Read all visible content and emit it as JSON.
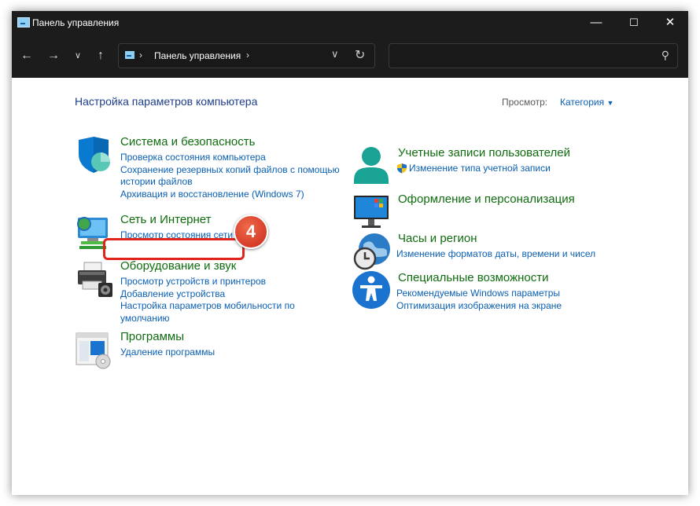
{
  "window": {
    "title": "Панель управления"
  },
  "address": {
    "crumb": "Панель управления"
  },
  "search": {
    "placeholder": ""
  },
  "heading": "Настройка параметров компьютера",
  "view": {
    "label": "Просмотр:",
    "value": "Категория"
  },
  "categories_left": [
    {
      "title": "Система и безопасность",
      "links": [
        "Проверка состояния компьютера",
        "Сохранение резервных копий файлов с помощью",
        "истории файлов",
        "Архивация и восстановление (Windows 7)"
      ]
    },
    {
      "title": "Сеть и Интернет",
      "links": [
        "Просмотр состояния сети и"
      ]
    },
    {
      "title": "Оборудование и звук",
      "links": [
        "Просмотр устройств и принтеров",
        "Добавление устройства",
        "Настройка параметров мобильности по",
        "умолчанию"
      ]
    },
    {
      "title": "Программы",
      "links": [
        "Удаление программы"
      ]
    }
  ],
  "categories_right": [
    {
      "title": "Учетные записи пользователей",
      "links": [
        "Изменение типа учетной записи"
      ]
    },
    {
      "title": "Оформление и персонализация",
      "links": []
    },
    {
      "title": "Часы и регион",
      "links": [
        "Изменение форматов даты, времени и чисел"
      ]
    },
    {
      "title": "Специальные возможности",
      "links": [
        "Рекомендуемые Windows параметры",
        "Оптимизация изображения на экране"
      ]
    }
  ],
  "callout": {
    "number": "4"
  },
  "colors": {
    "titlebar": "#1c1c1c",
    "category_title": "#0f6c0f",
    "link": "#0a5fb4",
    "heading": "#1e3d8a",
    "callout": "#e0231b"
  },
  "icons": [
    "shield-icon",
    "network-icon",
    "printer-icon",
    "programs-icon",
    "user-icon",
    "display-icon",
    "clock-globe-icon",
    "accessibility-icon"
  ]
}
